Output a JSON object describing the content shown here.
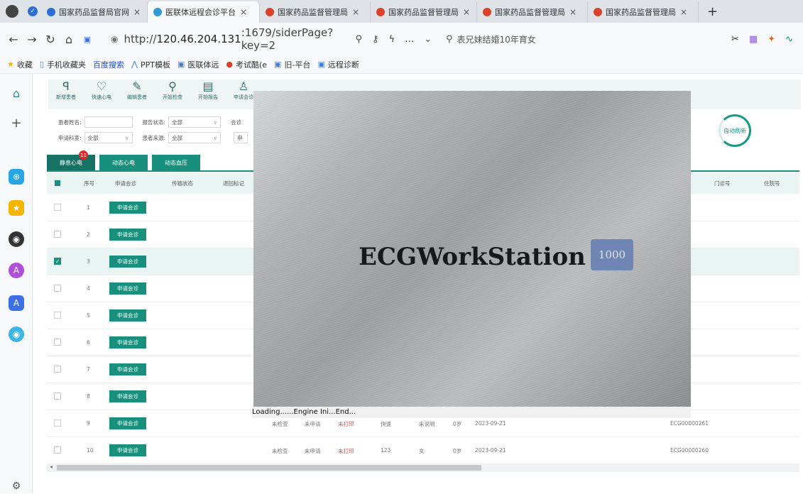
{
  "browser": {
    "tabs": [
      {
        "label": "国家药品监督局官网",
        "active": false,
        "color": "#2b6fd6"
      },
      {
        "label": "医联体远程会诊平台",
        "active": true,
        "color": "#2f9ad6"
      },
      {
        "label": "国家药品监督管理局",
        "active": false,
        "color": "#d9412b"
      },
      {
        "label": "国家药品监督管理局",
        "active": false,
        "color": "#d9412b"
      },
      {
        "label": "国家药品监督管理局",
        "active": false,
        "color": "#d9412b"
      },
      {
        "label": "国家药品监督管理局",
        "active": false,
        "color": "#d9412b"
      }
    ],
    "close_glyph": "×",
    "new_tab_glyph": "+",
    "url_prefix": "http://",
    "url_host": "120.46.204.131",
    "url_rest": ":1679/siderPage?key=2",
    "search_text": "表兄妹结婚10年育女",
    "bookmarks": [
      {
        "label": "收藏",
        "icon": "★"
      },
      {
        "label": "手机收藏夹",
        "icon": "▯"
      },
      {
        "label": "百度搜索",
        "icon": ""
      },
      {
        "label": "PPT模板",
        "icon": "⋀"
      },
      {
        "label": "医联体远",
        "icon": "▣"
      },
      {
        "label": "考试酷(e",
        "icon": "●"
      },
      {
        "label": "旧-平台",
        "icon": "▣"
      },
      {
        "label": "远程诊断",
        "icon": "▣"
      }
    ]
  },
  "toolbar": {
    "items": [
      {
        "label": "新增患者",
        "icon": "ꟼ"
      },
      {
        "label": "快速心电",
        "icon": "♡"
      },
      {
        "label": "编辑患者",
        "icon": "✎"
      },
      {
        "label": "开始检查",
        "icon": "⚲"
      },
      {
        "label": "开始报告",
        "icon": "▤"
      },
      {
        "label": "申请会诊",
        "icon": "♙"
      }
    ]
  },
  "filters": {
    "patient_name_label": "患者姓名:",
    "report_status_label": "报告状态:",
    "report_status_value": "全部",
    "consult_label": "会诊",
    "apply_dept_label": "申请科室:",
    "apply_dept_value": "全部",
    "patient_source_label": "患者来源:",
    "patient_source_value": "全部",
    "apply_short_label": "申",
    "auto_refresh_label": "自动刷新"
  },
  "data_tabs": [
    {
      "label": "静息心电",
      "badge": "11",
      "active": true
    },
    {
      "label": "动态心电",
      "badge": "",
      "active": false
    },
    {
      "label": "动态血压",
      "badge": "",
      "active": false
    }
  ],
  "table": {
    "headers": [
      "序号",
      "申请会诊",
      "传输状态",
      "退回标记",
      "门诊号",
      "住院号"
    ],
    "button_label": "申请会诊",
    "rows": [
      {
        "idx": "1",
        "checked": false
      },
      {
        "idx": "2",
        "checked": false
      },
      {
        "idx": "3",
        "checked": true
      },
      {
        "idx": "4",
        "checked": false
      },
      {
        "idx": "5",
        "checked": false
      },
      {
        "idx": "6",
        "checked": false
      },
      {
        "idx": "7",
        "checked": false
      },
      {
        "idx": "8",
        "checked": false
      },
      {
        "idx": "9",
        "checked": false,
        "exam": "未检查",
        "apply": "未申请",
        "print": "未打印",
        "name": "快速",
        "gender": "未说明",
        "age": "0岁",
        "date": "2023-09-21",
        "ecg": "ECG00000261"
      },
      {
        "idx": "10",
        "checked": false,
        "exam": "未检查",
        "apply": "未申请",
        "print": "未打印",
        "name": "123",
        "gender": "女",
        "age": "0岁",
        "date": "2023-09-21",
        "ecg": "ECG00000260"
      }
    ]
  },
  "splash": {
    "title": "ECGWorkStation",
    "edition": "1000",
    "loading_text": "Loading......Engine Ini...End..."
  },
  "colors": {
    "accent": "#19907e",
    "badge": "#e02b2b"
  }
}
